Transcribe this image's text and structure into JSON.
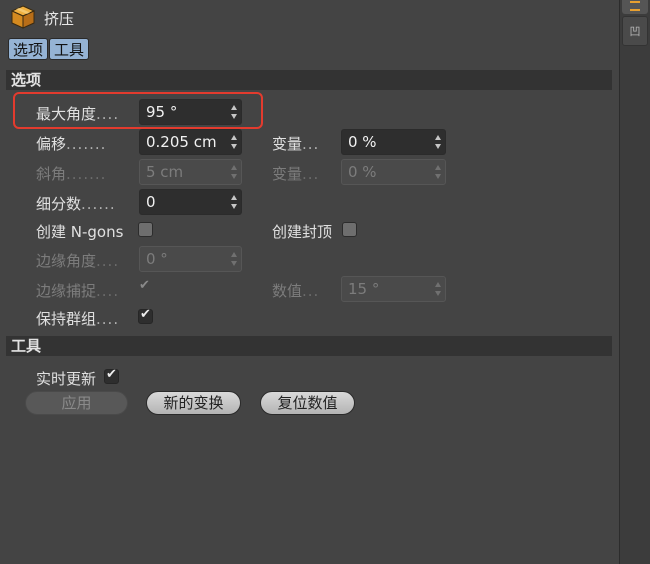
{
  "title": "挤压",
  "tabs": [
    "选项",
    "工具"
  ],
  "side_tab_label": "凹",
  "sections": {
    "options": "选项",
    "tools": "工具"
  },
  "options": {
    "max_angle": {
      "label": "最大角度",
      "dots": "....",
      "value": "95 °"
    },
    "offset": {
      "label": "偏移",
      "dots": ".......",
      "value": "0.205 cm"
    },
    "offset_variation": {
      "label": "变量",
      "dots": "...",
      "value": "0 %"
    },
    "bevel": {
      "label": "斜角",
      "dots": ".......",
      "value": "5 cm"
    },
    "bevel_variation": {
      "label": "变量",
      "dots": "...",
      "value": "0 %"
    },
    "subdivision": {
      "label": "细分数",
      "dots": "......",
      "value": "0"
    },
    "create_ngons": {
      "label": "创建 N-gons",
      "checked": false
    },
    "create_caps": {
      "label": "创建封顶",
      "checked": false
    },
    "edge_angle": {
      "label": "边缘角度",
      "dots": "....",
      "value": "0 °"
    },
    "edge_snap": {
      "label": "边缘捕捉",
      "dots": "....",
      "checked": true
    },
    "value": {
      "label": "数值",
      "dots": "...",
      "value": "15 °"
    },
    "preserve_groups": {
      "label": "保持群组",
      "dots": "....",
      "checked": true
    }
  },
  "tools": {
    "realtime_update": {
      "label": "实时更新",
      "checked": true
    },
    "apply_button": "应用",
    "new_transform_button": "新的变换",
    "reset_values_button": "复位数值"
  },
  "colors": {
    "background": "#444444",
    "tab_active": "#95b3d4",
    "highlight_box": "#e33b2e",
    "icon_orange": "#e8a030"
  }
}
